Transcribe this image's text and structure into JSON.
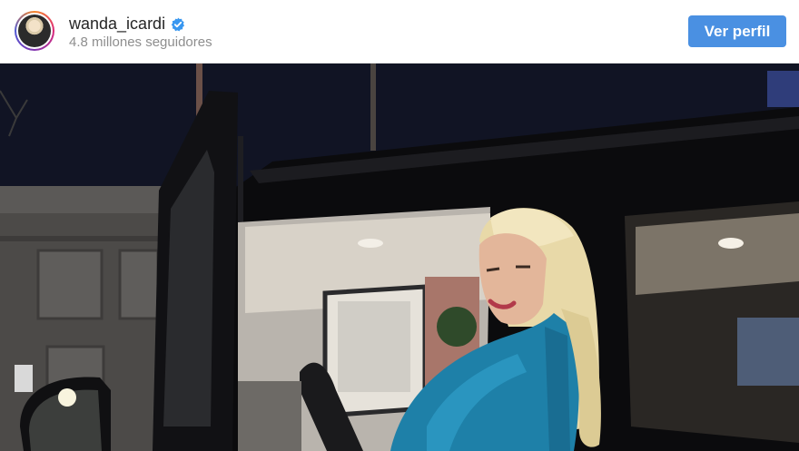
{
  "profile": {
    "username": "wanda_icardi",
    "followers": "4.8 millones seguidores",
    "verified": true,
    "verified_color": "#3897f0"
  },
  "actions": {
    "view_profile_label": "Ver perfil",
    "button_color": "#4a90e2"
  },
  "post": {
    "image_icon": "photo-image"
  }
}
